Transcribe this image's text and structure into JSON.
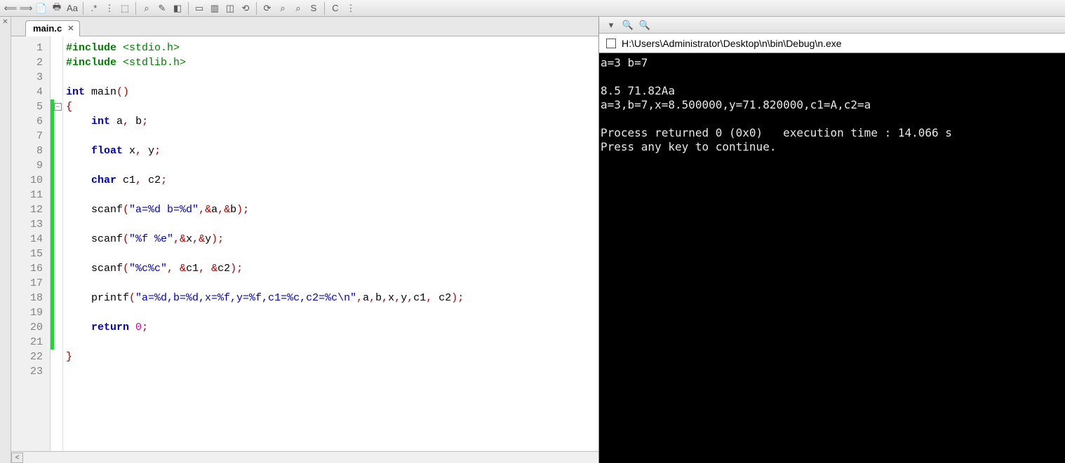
{
  "tab": {
    "filename": "main.c"
  },
  "console": {
    "title": "H:\\Users\\Administrator\\Desktop\\n\\bin\\Debug\\n.exe",
    "lines": [
      "a=3 b=7",
      "",
      "8.5 71.82Aa",
      "a=3,b=7,x=8.500000,y=71.820000,c1=A,c2=a",
      "",
      "Process returned 0 (0x0)   execution time : 14.066 s",
      "Press any key to continue."
    ]
  },
  "code": {
    "lines": [
      {
        "n": 1,
        "t": [
          [
            "pp",
            "#include "
          ],
          [
            "pp-arg",
            "<stdio.h>"
          ]
        ]
      },
      {
        "n": 2,
        "t": [
          [
            "pp",
            "#include "
          ],
          [
            "pp-arg",
            "<stdlib.h>"
          ]
        ]
      },
      {
        "n": 3,
        "t": []
      },
      {
        "n": 4,
        "t": [
          [
            "kw",
            "int"
          ],
          [
            "id",
            " main"
          ],
          [
            "punc",
            "()"
          ]
        ]
      },
      {
        "n": 5,
        "t": [
          [
            "punc",
            "{"
          ]
        ]
      },
      {
        "n": 6,
        "t": [
          [
            "id",
            "    "
          ],
          [
            "kw",
            "int"
          ],
          [
            "id",
            " a"
          ],
          [
            "punc",
            ","
          ],
          [
            "id",
            " b"
          ],
          [
            "punc",
            ";"
          ]
        ]
      },
      {
        "n": 7,
        "t": []
      },
      {
        "n": 8,
        "t": [
          [
            "id",
            "    "
          ],
          [
            "kw",
            "float"
          ],
          [
            "id",
            " x"
          ],
          [
            "punc",
            ","
          ],
          [
            "id",
            " y"
          ],
          [
            "punc",
            ";"
          ]
        ]
      },
      {
        "n": 9,
        "t": []
      },
      {
        "n": 10,
        "t": [
          [
            "id",
            "    "
          ],
          [
            "kw",
            "char"
          ],
          [
            "id",
            " c1"
          ],
          [
            "punc",
            ","
          ],
          [
            "id",
            " c2"
          ],
          [
            "punc",
            ";"
          ]
        ]
      },
      {
        "n": 11,
        "t": []
      },
      {
        "n": 12,
        "t": [
          [
            "id",
            "    scanf"
          ],
          [
            "punc",
            "("
          ],
          [
            "str",
            "\"a=%d b=%d\""
          ],
          [
            "punc",
            ",&"
          ],
          [
            "id",
            "a"
          ],
          [
            "punc",
            ",&"
          ],
          [
            "id",
            "b"
          ],
          [
            "punc",
            ");"
          ]
        ]
      },
      {
        "n": 13,
        "t": []
      },
      {
        "n": 14,
        "t": [
          [
            "id",
            "    scanf"
          ],
          [
            "punc",
            "("
          ],
          [
            "str",
            "\"%f %e\""
          ],
          [
            "punc",
            ",&"
          ],
          [
            "id",
            "x"
          ],
          [
            "punc",
            ",&"
          ],
          [
            "id",
            "y"
          ],
          [
            "punc",
            ");"
          ]
        ]
      },
      {
        "n": 15,
        "t": []
      },
      {
        "n": 16,
        "t": [
          [
            "id",
            "    scanf"
          ],
          [
            "punc",
            "("
          ],
          [
            "str",
            "\"%c%c\""
          ],
          [
            "punc",
            ", &"
          ],
          [
            "id",
            "c1"
          ],
          [
            "punc",
            ", &"
          ],
          [
            "id",
            "c2"
          ],
          [
            "punc",
            ");"
          ]
        ]
      },
      {
        "n": 17,
        "t": []
      },
      {
        "n": 18,
        "t": [
          [
            "id",
            "    printf"
          ],
          [
            "punc",
            "("
          ],
          [
            "str",
            "\"a=%d,b=%d,x=%f,y=%f,c1=%c,c2=%c\\n\""
          ],
          [
            "punc",
            ","
          ],
          [
            "id",
            "a"
          ],
          [
            "punc",
            ","
          ],
          [
            "id",
            "b"
          ],
          [
            "punc",
            ","
          ],
          [
            "id",
            "x"
          ],
          [
            "punc",
            ","
          ],
          [
            "id",
            "y"
          ],
          [
            "punc",
            ","
          ],
          [
            "id",
            "c1"
          ],
          [
            "punc",
            ", "
          ],
          [
            "id",
            "c2"
          ],
          [
            "punc",
            ");"
          ]
        ]
      },
      {
        "n": 19,
        "t": []
      },
      {
        "n": 20,
        "t": [
          [
            "id",
            "    "
          ],
          [
            "kw",
            "return"
          ],
          [
            "id",
            " "
          ],
          [
            "num",
            "0"
          ],
          [
            "punc",
            ";"
          ]
        ]
      },
      {
        "n": 21,
        "t": []
      },
      {
        "n": 22,
        "t": [
          [
            "punc",
            "}"
          ]
        ]
      },
      {
        "n": 23,
        "t": []
      }
    ]
  },
  "toolbar_icons": [
    "⟸",
    "⟹",
    "📄",
    "🖶",
    "Aa",
    ".*",
    "⋮",
    "⬚",
    "⌕",
    "✎",
    "◧",
    "▭",
    "▥",
    "◫",
    "⟲",
    "⟳",
    "⌕",
    "⌕",
    "S",
    "C",
    "⋮"
  ],
  "right_icons": [
    "▾",
    "🔍",
    "🔍"
  ]
}
